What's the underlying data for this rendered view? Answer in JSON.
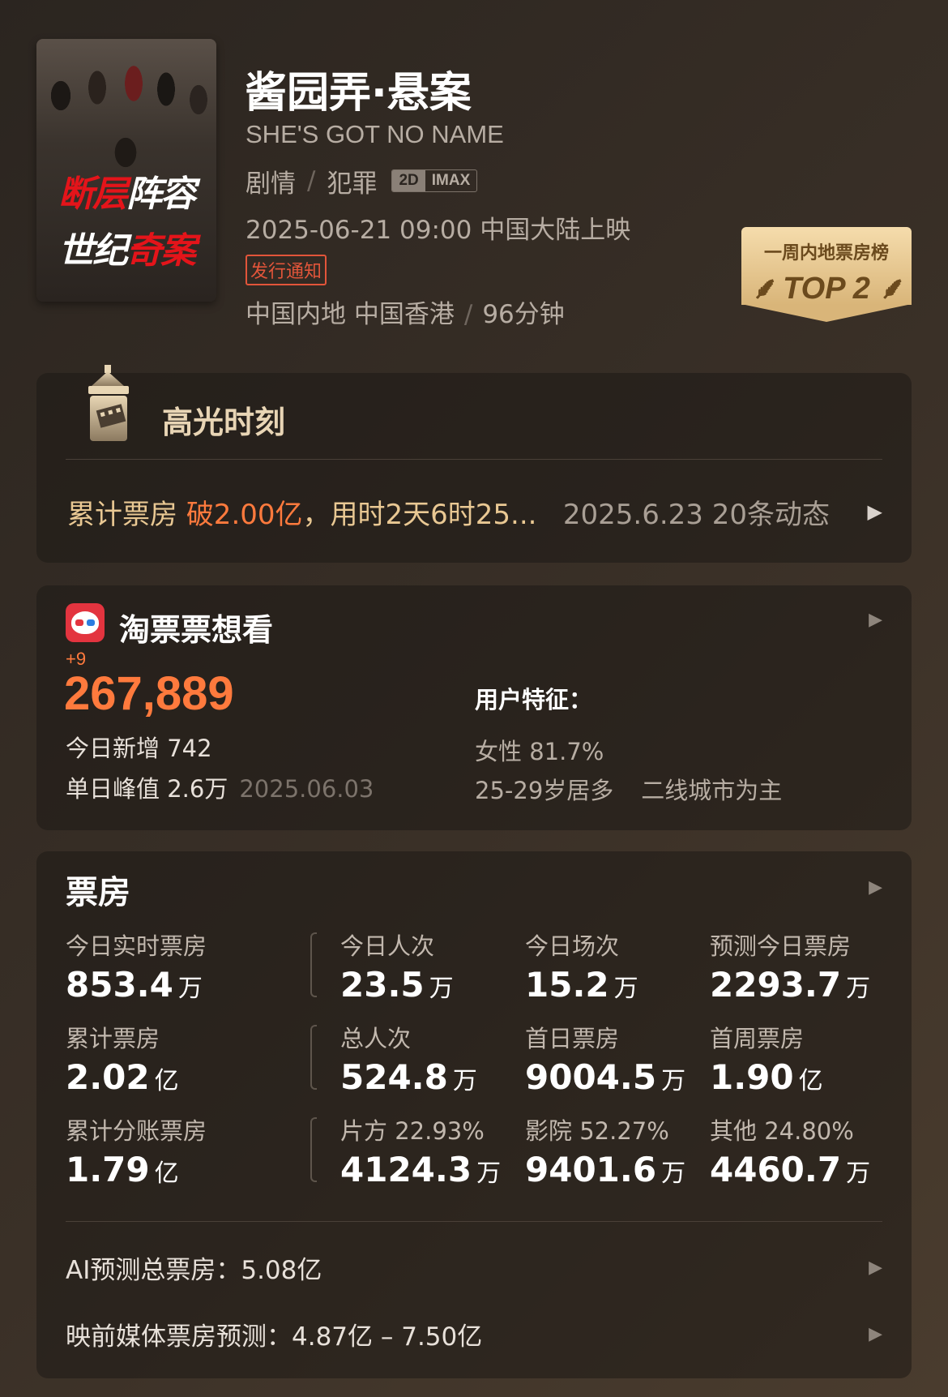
{
  "movie": {
    "poster_text_line1_a": "断层",
    "poster_text_line1_b": "阵容",
    "poster_text_line2_a": "世纪",
    "poster_text_line2_b": "奇案",
    "title": "酱园弄·悬案",
    "en_title": "SHE'S GOT NO NAME",
    "genres": [
      "剧情",
      "犯罪"
    ],
    "formats": [
      "2D",
      "IMAX"
    ],
    "release": "2025-06-21 09:00 中国大陆上映",
    "notice_tag": "发行通知",
    "regions": "中国内地 中国香港",
    "duration": "96分钟"
  },
  "top_badge": {
    "label": "一周内地票房榜",
    "rank": "TOP 2"
  },
  "highlight": {
    "title": "高光时刻",
    "text_prefix": "累计票房 ",
    "text_highlight": "破2.00亿",
    "text_suffix": "，用时2天6时25...",
    "date_count": "2025.6.23  20条动态"
  },
  "taopiao": {
    "title": "淘票票想看",
    "delta": "+9",
    "count": "267,889",
    "today_new_label": "今日新增 742",
    "peak_label": "单日峰值 2.6万",
    "peak_date": "2025.06.03",
    "feature_title": "用户特征：",
    "feature_gender": "女性 81.7%",
    "feature_age": "25-29岁居多",
    "feature_city": "二线城市为主"
  },
  "box_office": {
    "title": "票房",
    "rows": [
      [
        {
          "label": "今日实时票房",
          "value": "853.4",
          "unit": "万"
        },
        {
          "label": "今日人次",
          "value": "23.5",
          "unit": "万"
        },
        {
          "label": "今日场次",
          "value": "15.2",
          "unit": "万"
        },
        {
          "label": "预测今日票房",
          "value": "2293.7",
          "unit": "万"
        }
      ],
      [
        {
          "label": "累计票房",
          "value": "2.02",
          "unit": "亿"
        },
        {
          "label": "总人次",
          "value": "524.8",
          "unit": "万"
        },
        {
          "label": "首日票房",
          "value": "9004.5",
          "unit": "万"
        },
        {
          "label": "首周票房",
          "value": "1.90",
          "unit": "亿"
        }
      ],
      [
        {
          "label": "累计分账票房",
          "value": "1.79",
          "unit": "亿"
        },
        {
          "label": "片方 22.93%",
          "value": "4124.3",
          "unit": "万"
        },
        {
          "label": "影院 52.27%",
          "value": "9401.6",
          "unit": "万"
        },
        {
          "label": "其他 24.80%",
          "value": "4460.7",
          "unit": "万"
        }
      ]
    ],
    "ai_forecast": "AI预测总票房：5.08亿",
    "media_forecast": "映前媒体票房预测：4.87亿 – 7.50亿"
  },
  "colors": {
    "accent_orange": "#ff7a3d",
    "gold": "#e9c893",
    "badge_gold": "#d9b579",
    "taopiao_red": "#e3343f"
  },
  "icons": {
    "play": "▶"
  }
}
